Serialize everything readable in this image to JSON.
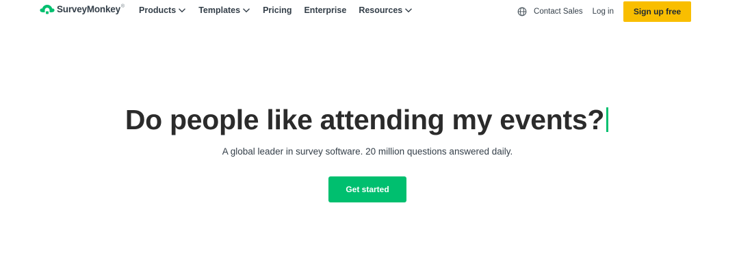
{
  "header": {
    "logo": {
      "text": "SurveyMonkey",
      "tm": "®",
      "icon": "surveymonkey-logo-icon",
      "color": "#00bf6f"
    },
    "nav": [
      {
        "label": "Products",
        "has_dropdown": true
      },
      {
        "label": "Templates",
        "has_dropdown": true
      },
      {
        "label": "Pricing",
        "has_dropdown": false
      },
      {
        "label": "Enterprise",
        "has_dropdown": false
      },
      {
        "label": "Resources",
        "has_dropdown": true
      }
    ],
    "globe_icon": "globe-icon",
    "contact_sales": "Contact Sales",
    "login": "Log in",
    "signup": "Sign up free",
    "signup_color": "#f9be00"
  },
  "hero": {
    "title": "Do people like attending my events?",
    "subtitle": "A global leader in survey software. 20 million questions answered daily.",
    "cta": "Get started",
    "cta_color": "#00bf6f",
    "cursor_color": "#00bf6f"
  }
}
